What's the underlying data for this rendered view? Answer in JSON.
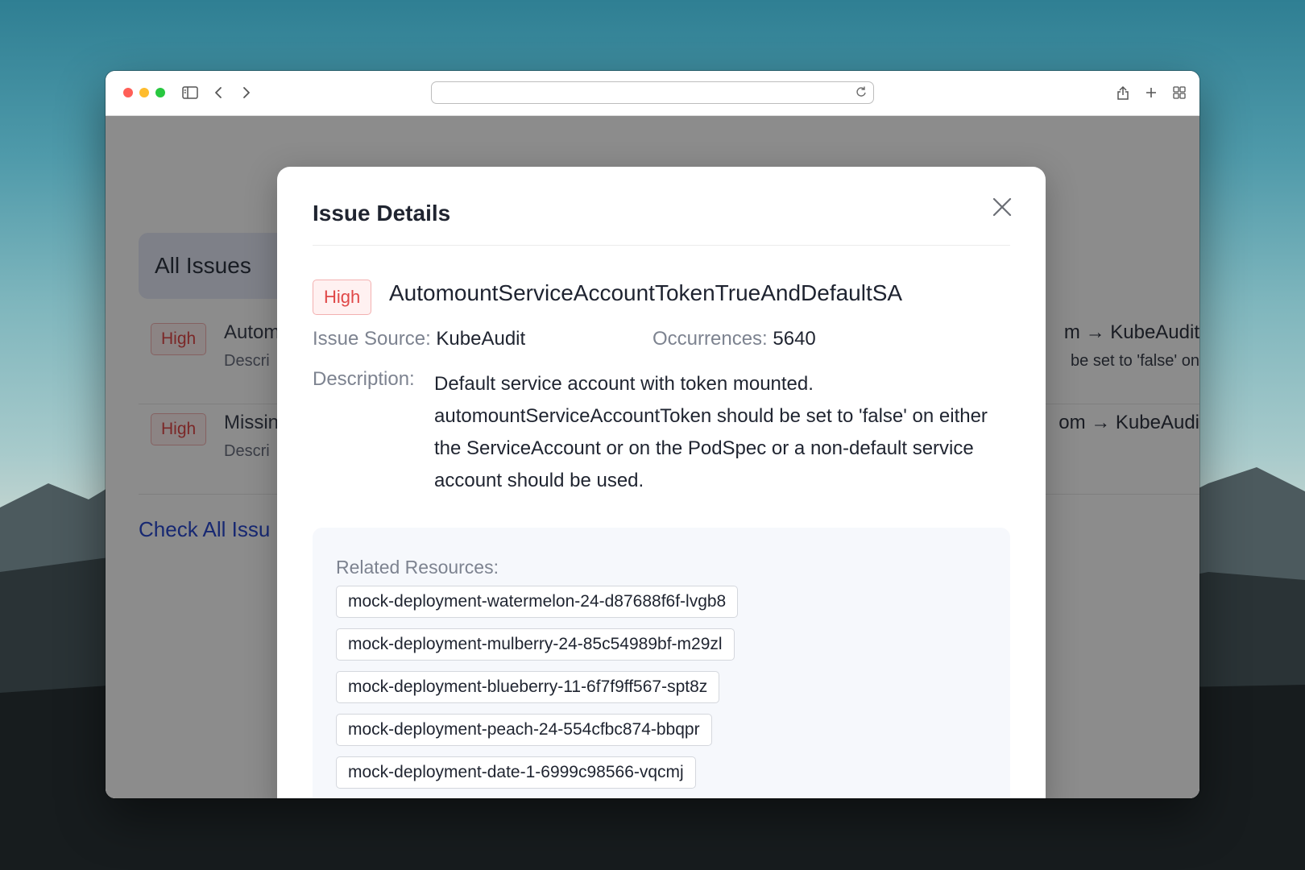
{
  "background_issues": {
    "tab_label": "All Issues",
    "rows": [
      {
        "severity": "High",
        "name": "Autom",
        "desc": "Descri",
        "right": "m  → KubeAudit",
        "right_desc": "be set to 'false' on"
      },
      {
        "severity": "High",
        "name": "Missin",
        "desc": "Descri",
        "right": "om  → KubeAudi",
        "right_desc": ""
      }
    ],
    "check_all_link": "Check All Issu"
  },
  "modal": {
    "title": "Issue Details",
    "close_icon": "close-icon",
    "severity": "High",
    "issue_name": "AutomountServiceAccountTokenTrueAndDefaultSA",
    "source_label": "Issue Source:",
    "source_value": "KubeAudit",
    "occurrences_label": "Occurrences:",
    "occurrences_value": "5640",
    "description_label": "Description:",
    "description": "Default service account with token mounted. automountServiceAccountToken should be set to 'false' on either the ServiceAccount or on the PodSpec or a non-default service account should be used.",
    "resources_label": "Related Resources:",
    "resources": [
      "mock-deployment-watermelon-24-d87688f6f-lvgb8",
      "mock-deployment-mulberry-24-85c54989bf-m29zl",
      "mock-deployment-blueberry-11-6f7f9ff567-spt8z",
      "mock-deployment-peach-24-554cfbc874-bbqpr",
      "mock-deployment-date-1-6999c98566-vqcmj"
    ]
  },
  "colors": {
    "severity_high": "#e04848",
    "link": "#2a4ad0"
  }
}
